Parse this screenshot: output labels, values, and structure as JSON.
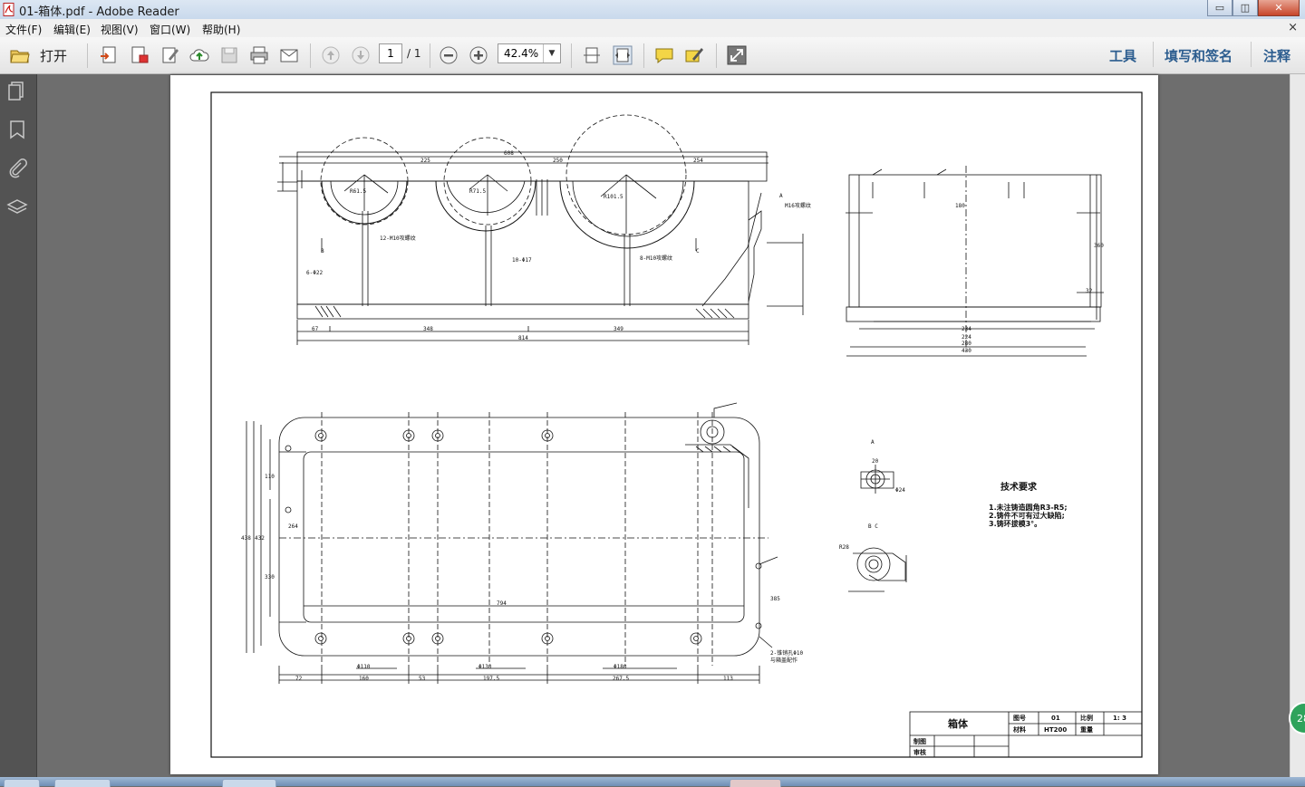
{
  "window": {
    "title": "01-箱体.pdf - Adobe Reader",
    "minimize_symbol": "▭",
    "maximize_symbol": "◫",
    "close_symbol": "✕"
  },
  "menu": {
    "items": [
      "文件(F)",
      "编辑(E)",
      "视图(V)",
      "窗口(W)",
      "帮助(H)"
    ],
    "close_symbol": "×"
  },
  "toolbar": {
    "open_label": "打开",
    "page_current": "1",
    "page_total": "/ 1",
    "zoom_value": "42.4%",
    "zoom_dropdown_symbol": "▼",
    "right_links": [
      "工具",
      "填写和签名",
      "注释"
    ]
  },
  "drawing": {
    "title_block": {
      "part_name": "箱体",
      "drawing_no_label": "图号",
      "drawing_no": "01",
      "scale_label": "比例",
      "scale": "1: 3",
      "material_label": "材料",
      "material": "HT200",
      "weight_label": "重量",
      "drawn_label": "制图",
      "checked_label": "审核"
    },
    "tech_req": {
      "title": "技术要求",
      "items": [
        "1.未注铸造圆角R3-R5;",
        "2.铸件不可有过大缺陷;",
        "3.铸环拔模3°。"
      ]
    },
    "front_dims": {
      "overall_top": "608",
      "seg1": "225",
      "seg2": "250",
      "seg3": "254",
      "bottom1": "67",
      "bottom2": "348",
      "bottom3": "349",
      "overall_bottom": "814",
      "hole_note1": "12-M10攻螺纹",
      "hole_note2": "8-M10攻螺纹",
      "hole_note3": "10-Φ17",
      "hole_note4": "6-Φ22",
      "hole_note5": "M16攻螺纹",
      "r1": "R61.5",
      "r2": "R71.5",
      "r3": "R101.5",
      "label_a": "A",
      "label_b": "B",
      "label_c": "C"
    },
    "side_dims": {
      "d1": "180",
      "d2": "234",
      "d3": "224",
      "d4": "280",
      "d5": "430",
      "h1": "360",
      "h2": "32"
    },
    "plan_dims": {
      "inner_len": "794",
      "b1": "72",
      "b2": "160",
      "b3": "53",
      "b4": "197.5",
      "b5": "267.5",
      "b6": "113",
      "phi1": "Φ110",
      "phi2": "Φ130",
      "phi3": "Φ180",
      "h1": "110",
      "h2": "330",
      "h3": "264",
      "h4": "432",
      "h5": "438",
      "h6": "385",
      "note_hole": "2-锥销孔Φ10",
      "note_hole2": "与箱盖配作"
    },
    "details": {
      "view_a": "A",
      "view_bc": "B C",
      "r_det": "R28",
      "d_det1": "20",
      "d_det2": "Φ24"
    }
  }
}
